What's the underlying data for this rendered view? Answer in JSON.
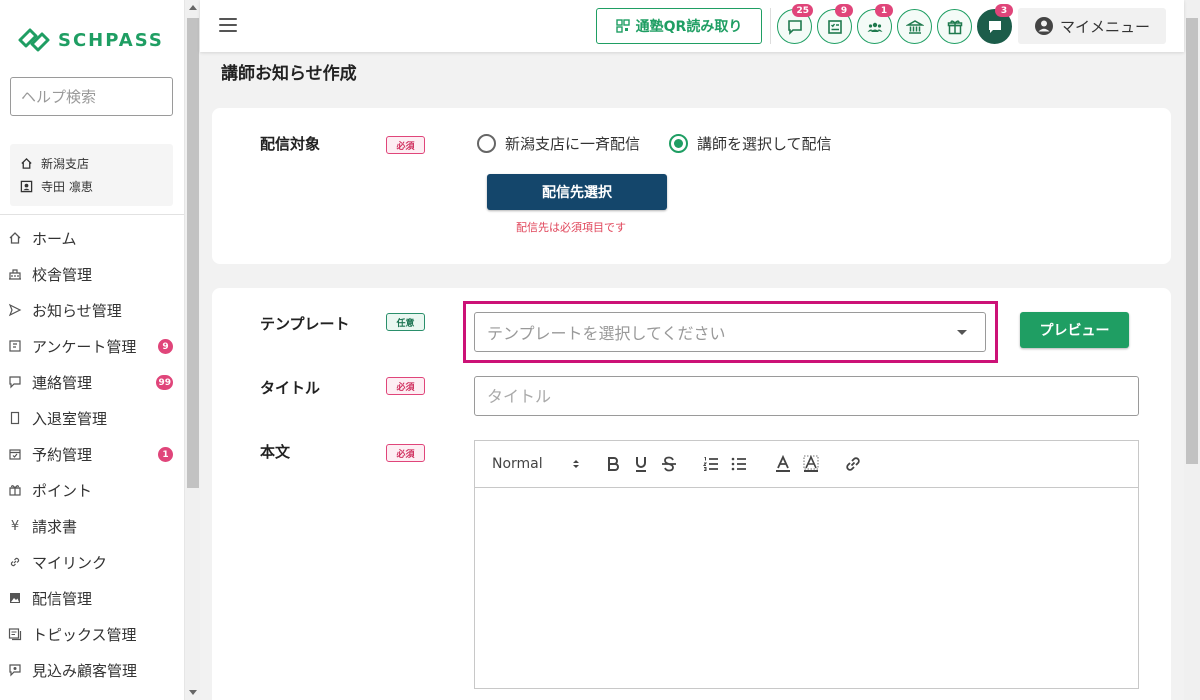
{
  "brand": {
    "name": "SCHPASS",
    "accent": "#1f9e63"
  },
  "sidebar": {
    "help_placeholder": "ヘルプ検索",
    "school": "新潟支店",
    "user": "寺田 凛恵",
    "items": [
      {
        "label": "ホーム",
        "icon": "home-icon"
      },
      {
        "label": "校舎管理",
        "icon": "building-icon"
      },
      {
        "label": "お知らせ管理",
        "icon": "send-icon"
      },
      {
        "label": "アンケート管理",
        "icon": "survey-icon",
        "badge": "9"
      },
      {
        "label": "連絡管理",
        "icon": "chat-icon",
        "badge": "99"
      },
      {
        "label": "入退室管理",
        "icon": "door-icon"
      },
      {
        "label": "予約管理",
        "icon": "calendar-icon",
        "badge": "1"
      },
      {
        "label": "ポイント",
        "icon": "gift-icon"
      },
      {
        "label": "請求書",
        "icon": "yen-icon"
      },
      {
        "label": "マイリンク",
        "icon": "link-icon"
      },
      {
        "label": "配信管理",
        "icon": "image-icon"
      },
      {
        "label": "トピックス管理",
        "icon": "topics-icon"
      },
      {
        "label": "見込み顧客管理",
        "icon": "prospect-icon"
      }
    ]
  },
  "header": {
    "qr_button": "通塾QR読み取り",
    "badges": {
      "messages": "25",
      "tasks": "9",
      "groups": "1",
      "chat": "3"
    },
    "my_menu": "マイメニュー"
  },
  "page": {
    "title": "講師お知らせ作成"
  },
  "form": {
    "delivery": {
      "label": "配信対象",
      "required": "必須",
      "option_all": "新潟支店に一斉配信",
      "option_select": "講師を選択して配信",
      "select_button": "配信先選択",
      "error": "配信先は必須項目です"
    },
    "template": {
      "label": "テンプレート",
      "optional": "任意",
      "placeholder": "テンプレートを選択してください",
      "preview_button": "プレビュー"
    },
    "title": {
      "label": "タイトル",
      "required": "必須",
      "placeholder": "タイトル"
    },
    "body": {
      "label": "本文",
      "required": "必須",
      "format": "Normal"
    }
  }
}
